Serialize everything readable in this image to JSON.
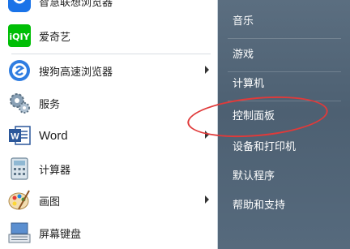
{
  "left_menu": {
    "items": [
      {
        "label": "智慧联想浏览器",
        "icon": "lenovo-browser-icon",
        "has_submenu": false
      },
      {
        "label": "爱奇艺",
        "icon": "iqiyi-icon",
        "has_submenu": false
      },
      {
        "label": "搜狗高速浏览器",
        "icon": "sogou-browser-icon",
        "has_submenu": true
      },
      {
        "label": "服务",
        "icon": "services-gear-icon",
        "has_submenu": false
      },
      {
        "label": "Word",
        "icon": "word-icon",
        "has_submenu": true
      },
      {
        "label": "计算器",
        "icon": "calculator-icon",
        "has_submenu": false
      },
      {
        "label": "画图",
        "icon": "paint-icon",
        "has_submenu": true
      },
      {
        "label": "屏幕键盘",
        "icon": "on-screen-keyboard-icon",
        "has_submenu": false
      }
    ]
  },
  "right_menu": {
    "items": [
      {
        "label": "音乐"
      },
      {
        "label": "游戏"
      },
      {
        "label": "计算机"
      },
      {
        "label": "控制面板"
      },
      {
        "label": "设备和打印机"
      },
      {
        "label": "默认程序"
      },
      {
        "label": "帮助和支持"
      }
    ]
  },
  "colors": {
    "right_panel": "#4d6072",
    "highlight_circle": "#e03a3a",
    "iqiyi_green": "#00be06",
    "word_blue": "#2b579a"
  }
}
